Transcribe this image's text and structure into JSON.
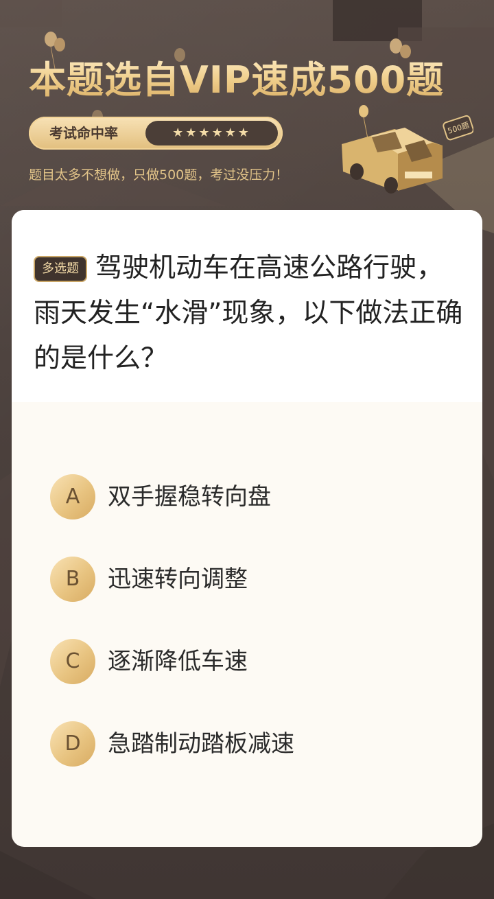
{
  "header": {
    "title": "本题选自VIP速成500题",
    "rate_label": "考试命中率",
    "stars": "★★★★★★",
    "subtitle": "题目太多不想做，只做500题，考过没压力！",
    "badge": "500题"
  },
  "question": {
    "type_tag": "多选题",
    "text": "驾驶机动车在高速公路行驶，雨天发生“水滑”现象，以下做法正确的是什么？"
  },
  "options": [
    {
      "letter": "A",
      "text": "双手握稳转向盘"
    },
    {
      "letter": "B",
      "text": "迅速转向调整"
    },
    {
      "letter": "C",
      "text": "逐渐降低车速"
    },
    {
      "letter": "D",
      "text": "急踏制动踏板减速"
    }
  ],
  "colors": {
    "background": "#4a3f3b",
    "gold": "#e8c481",
    "card": "#fdfaf4"
  }
}
